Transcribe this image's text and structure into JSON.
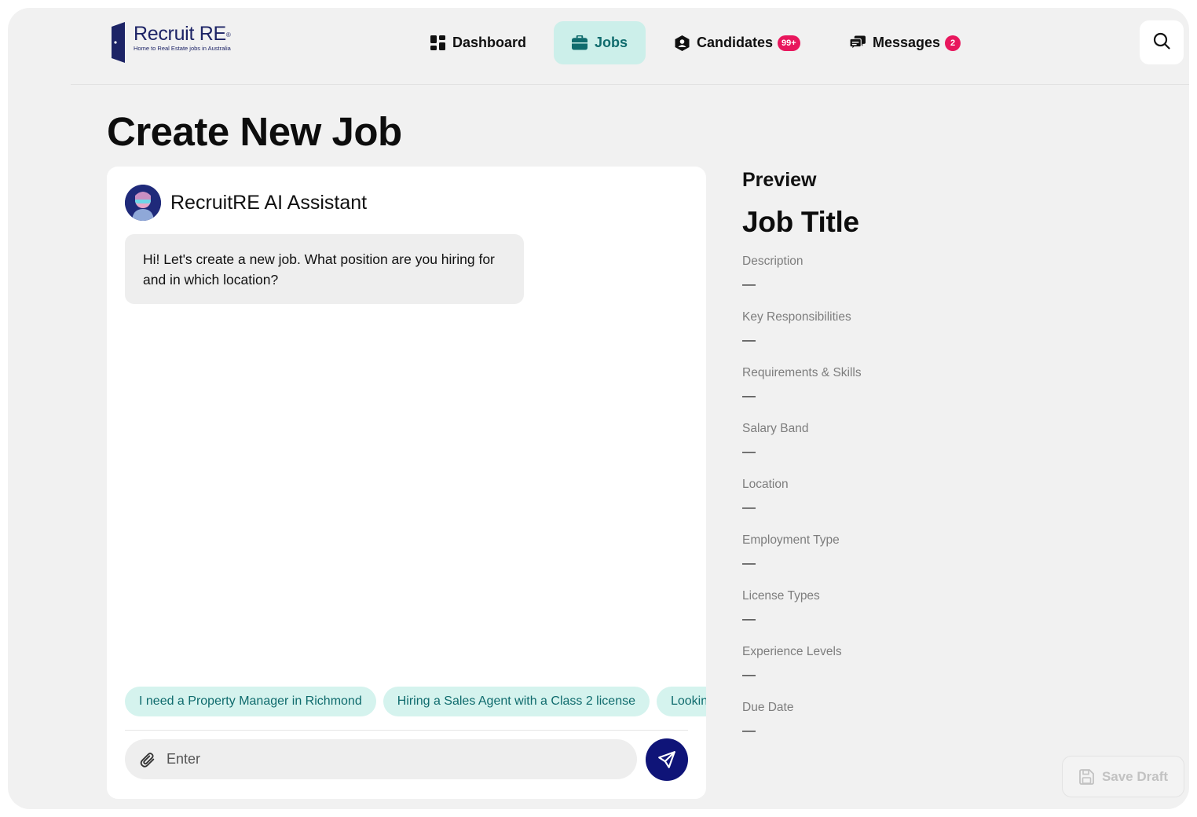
{
  "brand": {
    "name": "Recruit RE",
    "registered_mark": "®",
    "tagline": "Home to Real Estate jobs in Australia"
  },
  "nav": {
    "items": [
      {
        "label": "Dashboard",
        "icon": "grid-icon",
        "active": false
      },
      {
        "label": "Jobs",
        "icon": "briefcase-icon",
        "active": true
      },
      {
        "label": "Candidates",
        "icon": "user-hexagon-icon",
        "badge": "99+",
        "active": false
      },
      {
        "label": "Messages",
        "icon": "chat-bubbles-icon",
        "badge": "2",
        "active": false
      }
    ],
    "search_icon": "search-icon"
  },
  "page": {
    "title": "Create New Job"
  },
  "chat": {
    "assistant_name": "RecruitRE AI Assistant",
    "messages": [
      {
        "from": "assistant",
        "text": "Hi! Let's create a new job. What position are you hiring for and in which location?"
      }
    ],
    "suggestions": [
      "I need a Property Manager in Richmond",
      "Hiring a Sales Agent with a Class 2 license",
      "Looking fo"
    ],
    "input": {
      "placeholder": "Enter",
      "value": ""
    }
  },
  "preview": {
    "heading": "Preview",
    "job_title": "Job Title",
    "fields": [
      {
        "label": "Description",
        "value": "—"
      },
      {
        "label": "Key Responsibilities",
        "value": "—"
      },
      {
        "label": "Requirements & Skills",
        "value": "—"
      },
      {
        "label": "Salary Band",
        "value": "—"
      },
      {
        "label": "Location",
        "value": "—"
      },
      {
        "label": "Employment Type",
        "value": "—"
      },
      {
        "label": "License Types",
        "value": "—"
      },
      {
        "label": "Experience Levels",
        "value": "—"
      },
      {
        "label": "Due Date",
        "value": "—"
      }
    ]
  },
  "actions": {
    "save_draft": "Save Draft"
  },
  "colors": {
    "accent_teal": "#0f6b6d",
    "accent_teal_bg": "#ccefea",
    "badge_pink": "#e8175d",
    "brand_navy": "#1d2466",
    "send_navy": "#0f1478"
  }
}
